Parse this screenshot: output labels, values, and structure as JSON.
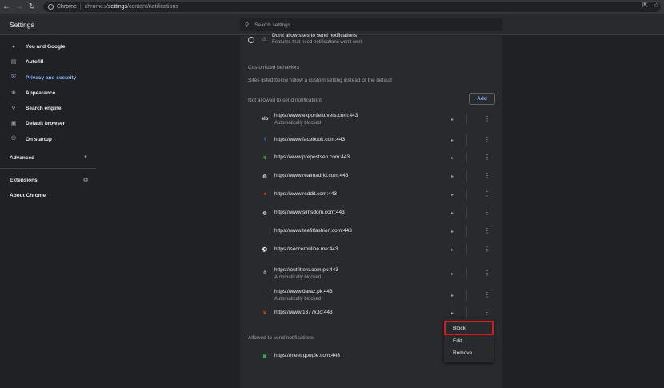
{
  "browser": {
    "tab_label": "Chrome",
    "url_prefix": "chrome://",
    "url_bold": "settings",
    "url_suffix": "/content/notifications"
  },
  "header": {
    "title": "Settings",
    "search_placeholder": "Search settings"
  },
  "sidebar": {
    "items": [
      {
        "label": "You and Google",
        "icon": "person-icon"
      },
      {
        "label": "Autofill",
        "icon": "clipboard-icon"
      },
      {
        "label": "Privacy and security",
        "icon": "shield-icon"
      },
      {
        "label": "Appearance",
        "icon": "palette-icon"
      },
      {
        "label": "Search engine",
        "icon": "search-icon"
      },
      {
        "label": "Default browser",
        "icon": "browser-icon"
      },
      {
        "label": "On startup",
        "icon": "power-icon"
      }
    ],
    "advanced": "Advanced",
    "extensions": "Extensions",
    "about": "About Chrome"
  },
  "main": {
    "top_option_partial": "Don't allow sites to send notifications",
    "top_option_sub": "Features that need notifications won't work",
    "custom_title": "Customized behaviors",
    "custom_desc": "Sites listed below follow a custom setting instead of the default",
    "blocked_title": "Not allowed to send notifications",
    "add_label": "Add",
    "blocked_sites": [
      {
        "url": "https://www.exportleftovers.com:443",
        "sub": "Automatically blocked",
        "fav": "elo",
        "fav_color": "#e8eaed"
      },
      {
        "url": "https://www.facebook.com:443",
        "sub": "",
        "fav": "f",
        "fav_color": "#1877f2"
      },
      {
        "url": "https://www.prepostseo.com:443",
        "sub": "",
        "fav": "↯",
        "fav_color": "#34a853"
      },
      {
        "url": "https://www.realmadrid.com:443",
        "sub": "",
        "fav": "◍",
        "fav_color": "#bdc1c6"
      },
      {
        "url": "https://www.reddit.com:443",
        "sub": "",
        "fav": "●",
        "fav_color": "#ff4500"
      },
      {
        "url": "https://www.simsdom.com:443",
        "sub": "",
        "fav": "◍",
        "fav_color": "#bdc1c6"
      },
      {
        "url": "https://www.teefitfashion.com:443",
        "sub": "",
        "fav": "",
        "fav_color": "#202124"
      },
      {
        "url": "https://socceronline.me:443",
        "sub": "",
        "fav": "⚽",
        "fav_color": "#e8eaed"
      },
      {
        "url": "https://outfitters.com.pk:443",
        "sub": "Automatically blocked",
        "fav": "0",
        "fav_color": "#bdc1c6"
      },
      {
        "url": "https://www.daraz.pk:443",
        "sub": "Automatically blocked",
        "fav": "~",
        "fav_color": "#f57224"
      },
      {
        "url": "https://www.1377x.to:443",
        "sub": "",
        "fav": "✕",
        "fav_color": "#e34b2a"
      }
    ],
    "allowed_title": "Allowed to send notifications",
    "allowed_sites": [
      {
        "url": "https://meet.google.com:443",
        "fav": "◼",
        "fav_color": "#34a853"
      }
    ]
  },
  "context_menu": {
    "items": [
      "Block",
      "Edit",
      "Remove"
    ],
    "highlight_color": "#e3141c"
  }
}
